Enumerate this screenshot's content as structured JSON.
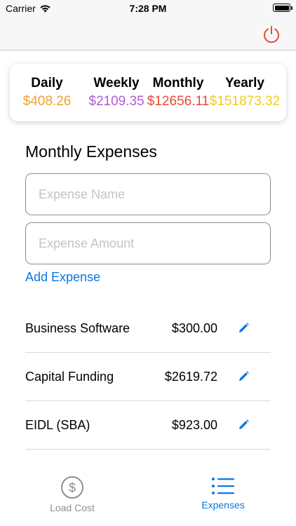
{
  "status_bar": {
    "carrier": "Carrier",
    "time": "7:28 PM"
  },
  "colors": {
    "daily": "#f0a030",
    "weekly": "#b25ad7",
    "monthly": "#e8483a",
    "yearly": "#f2cc1e",
    "accent": "#0a78e0",
    "power": "#e8483a"
  },
  "summary": {
    "daily": {
      "label": "Daily",
      "value": "$408.26"
    },
    "weekly": {
      "label": "Weekly",
      "value": "$2109.35"
    },
    "monthly": {
      "label": "Monthly",
      "value": "$12656.11"
    },
    "yearly": {
      "label": "Yearly",
      "value": "$151873.32"
    }
  },
  "section_title": "Monthly Expenses",
  "form": {
    "name_placeholder": "Expense Name",
    "amount_placeholder": "Expense Amount",
    "add_label": "Add Expense"
  },
  "expenses": [
    {
      "name": "Business Software",
      "amount": "$300.00"
    },
    {
      "name": "Capital Funding",
      "amount": "$2619.72"
    },
    {
      "name": "EIDL (SBA)",
      "amount": "$923.00"
    }
  ],
  "tabs": [
    {
      "label": "Load Cost",
      "icon": "dollar-circle-icon"
    },
    {
      "label": "Expenses",
      "icon": "list-icon"
    }
  ]
}
